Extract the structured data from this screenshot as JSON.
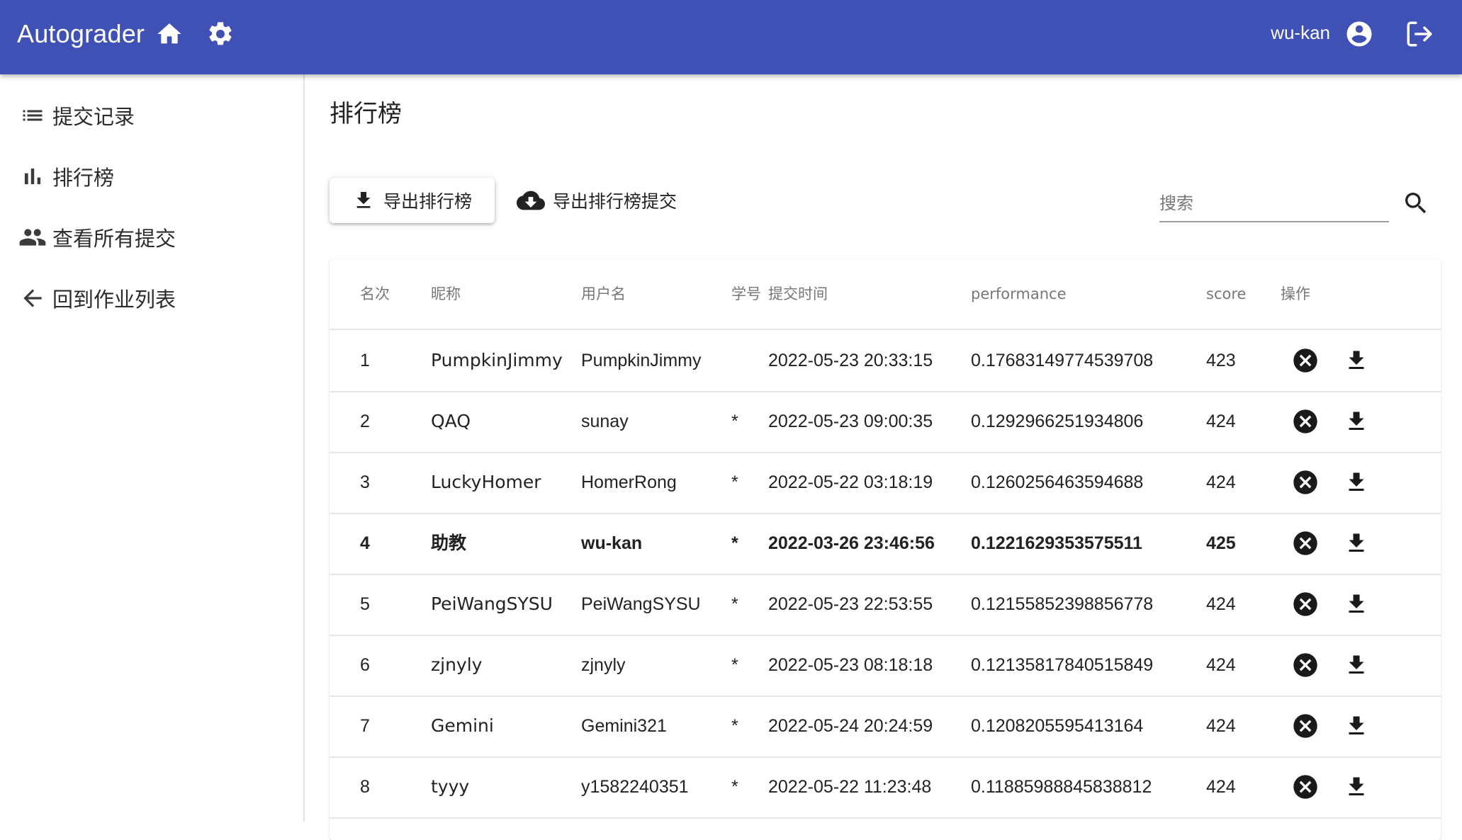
{
  "app": {
    "title": "Autograder",
    "username": "wu-kan"
  },
  "sidebar": {
    "items": [
      {
        "label": "提交记录",
        "icon": "list-icon"
      },
      {
        "label": "排行榜",
        "icon": "bar-chart-icon"
      },
      {
        "label": "查看所有提交",
        "icon": "people-icon"
      },
      {
        "label": "回到作业列表",
        "icon": "arrow-back-icon"
      }
    ]
  },
  "main": {
    "title": "排行榜",
    "export_button": "导出排行榜",
    "export_submissions_button": "导出排行榜提交",
    "search_placeholder": "搜索"
  },
  "table": {
    "headers": {
      "rank": "名次",
      "nickname": "昵称",
      "username": "用户名",
      "student_id": "学号",
      "time": "提交时间",
      "performance": "performance",
      "score": "score",
      "actions": "操作"
    },
    "rows": [
      {
        "rank": "1",
        "nickname": "PumpkinJimmy",
        "username": "PumpkinJimmy",
        "student_id": "",
        "time": "2022-05-23 20:33:15",
        "performance": "0.17683149774539708",
        "score": "423",
        "highlighted": false
      },
      {
        "rank": "2",
        "nickname": "QAQ",
        "username": "sunay",
        "student_id": "*",
        "time": "2022-05-23 09:00:35",
        "performance": "0.1292966251934806",
        "score": "424",
        "highlighted": false
      },
      {
        "rank": "3",
        "nickname": "LuckyHomer",
        "username": "HomerRong",
        "student_id": "*",
        "time": "2022-05-22 03:18:19",
        "performance": "0.1260256463594688",
        "score": "424",
        "highlighted": false
      },
      {
        "rank": "4",
        "nickname": "助教",
        "username": "wu-kan",
        "student_id": "*",
        "time": "2022-03-26 23:46:56",
        "performance": "0.1221629353575511",
        "score": "425",
        "highlighted": true
      },
      {
        "rank": "5",
        "nickname": "PeiWangSYSU",
        "username": "PeiWangSYSU",
        "student_id": "*",
        "time": "2022-05-23 22:53:55",
        "performance": "0.12155852398856778",
        "score": "424",
        "highlighted": false
      },
      {
        "rank": "6",
        "nickname": "zjnyly",
        "username": "zjnyly",
        "student_id": "*",
        "time": "2022-05-23 08:18:18",
        "performance": "0.12135817840515849",
        "score": "424",
        "highlighted": false
      },
      {
        "rank": "7",
        "nickname": "Gemini",
        "username": "Gemini321",
        "student_id": "*",
        "time": "2022-05-24 20:24:59",
        "performance": "0.1208205595413164",
        "score": "424",
        "highlighted": false
      },
      {
        "rank": "8",
        "nickname": "tyyy",
        "username": "y1582240351",
        "student_id": "*",
        "time": "2022-05-22 11:23:48",
        "performance": "0.11885988845838812",
        "score": "424",
        "highlighted": false
      }
    ]
  },
  "colors": {
    "appbar": "#3f51b5"
  }
}
